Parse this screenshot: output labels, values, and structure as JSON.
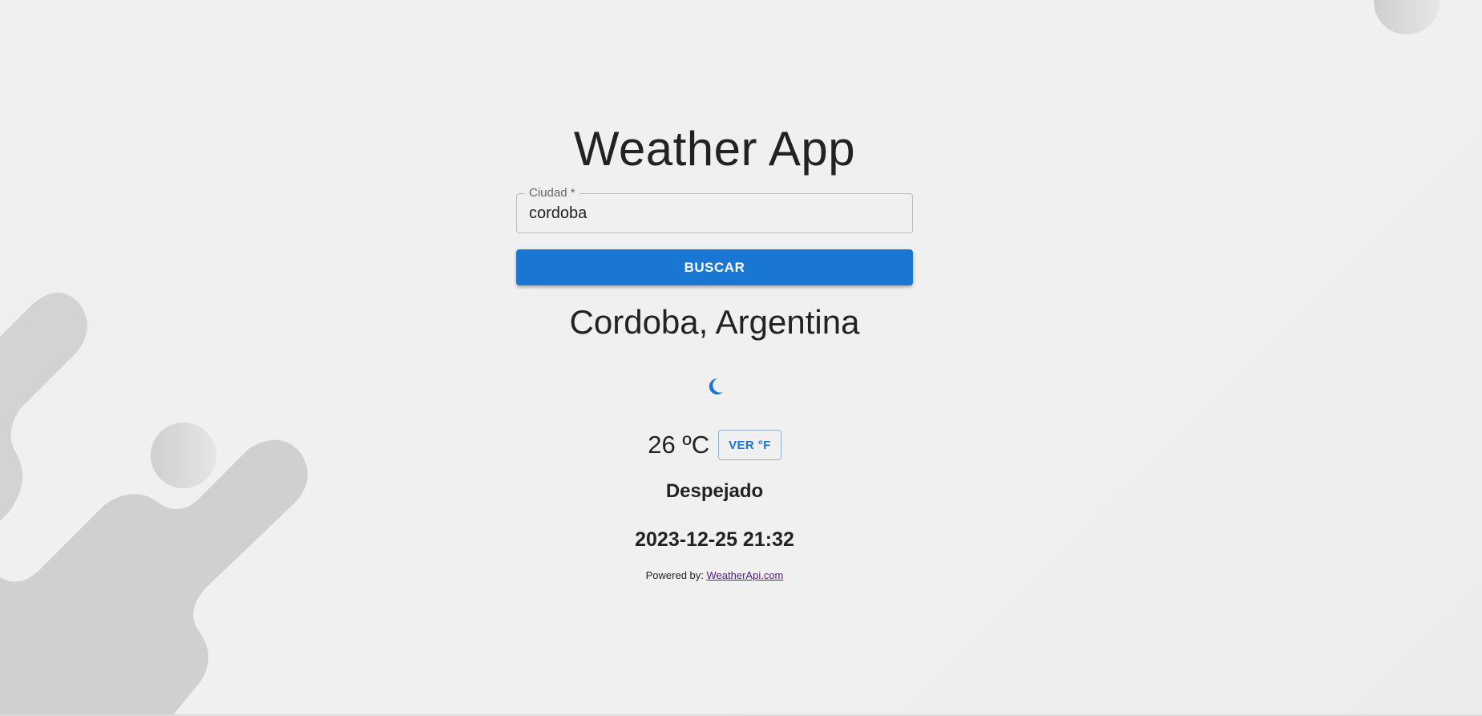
{
  "app": {
    "title": "Weather App"
  },
  "search": {
    "label": "Ciudad *",
    "value": "cordoba",
    "button_label": "BUSCAR"
  },
  "result": {
    "location": "Cordoba, Argentina",
    "icon": "crescent-moon-icon",
    "temperature": "26 ºC",
    "unit_toggle_label": "VER °F",
    "condition": "Despejado",
    "datetime": "2023-12-25 21:32"
  },
  "footer": {
    "powered_prefix": "Powered by:",
    "powered_link": "WeatherApi.com"
  },
  "colors": {
    "background": "#f0f0f0",
    "accent": "#1976d2",
    "decor_shape": "#d2d2d2",
    "text": "#222222"
  }
}
